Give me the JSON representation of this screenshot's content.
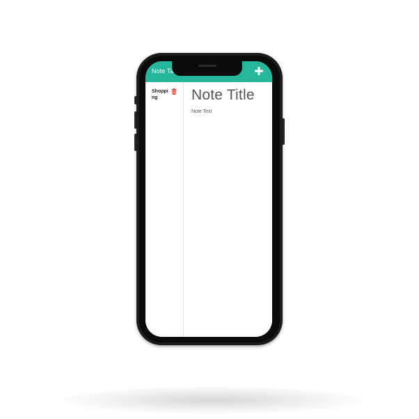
{
  "header": {
    "title": "Note Taker",
    "add_icon": "plus-icon",
    "color": "#25b79b"
  },
  "sidebar": {
    "items": [
      {
        "label": "Shopping",
        "delete_icon": "trash-icon",
        "delete_color": "#e53935"
      }
    ]
  },
  "editor": {
    "title_placeholder": "Note Title",
    "text_placeholder": "Note Text"
  }
}
